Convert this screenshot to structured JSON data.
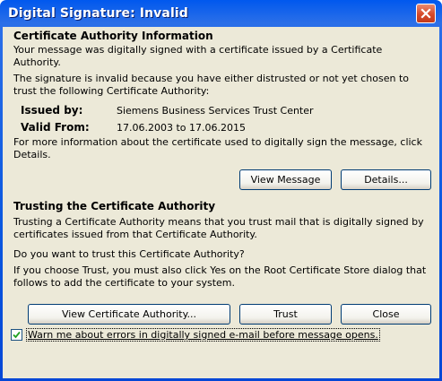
{
  "window": {
    "title": "Digital Signature: Invalid"
  },
  "ca_info": {
    "heading": "Certificate Authority Information",
    "para1": "Your message was digitally signed with a certificate issued by a Certificate Authority.",
    "para2": "The signature is invalid because you have either distrusted or not yet chosen to trust the following Certificate Authority:",
    "issued_by_label": "Issued by:",
    "issued_by_value": "Siemens Business Services Trust Center",
    "valid_from_label": "Valid From:",
    "valid_from_value": "17.06.2003 to 17.06.2015",
    "para3": "For more information about the certificate used to digitally sign the message, click Details."
  },
  "buttons": {
    "view_message": "View Message",
    "details": "Details...",
    "view_ca": "View Certificate Authority...",
    "trust": "Trust",
    "close": "Close"
  },
  "trusting": {
    "heading": "Trusting the Certificate Authority",
    "para1": "Trusting a Certificate Authority means that you trust mail that is digitally signed by certificates issued from that Certificate Authority.",
    "para2": "Do you want to trust this Certificate Authority?",
    "para3": "If you choose Trust, you must also click Yes on the Root Certificate Store dialog that follows to add the certificate to your system."
  },
  "warn_checkbox": {
    "label": "Warn me about errors in digitally signed e-mail before message opens.",
    "checked": true
  },
  "colors": {
    "titlebar": "#0a57e0",
    "client_bg": "#ece9d8",
    "close_btn": "#d64a2a"
  }
}
